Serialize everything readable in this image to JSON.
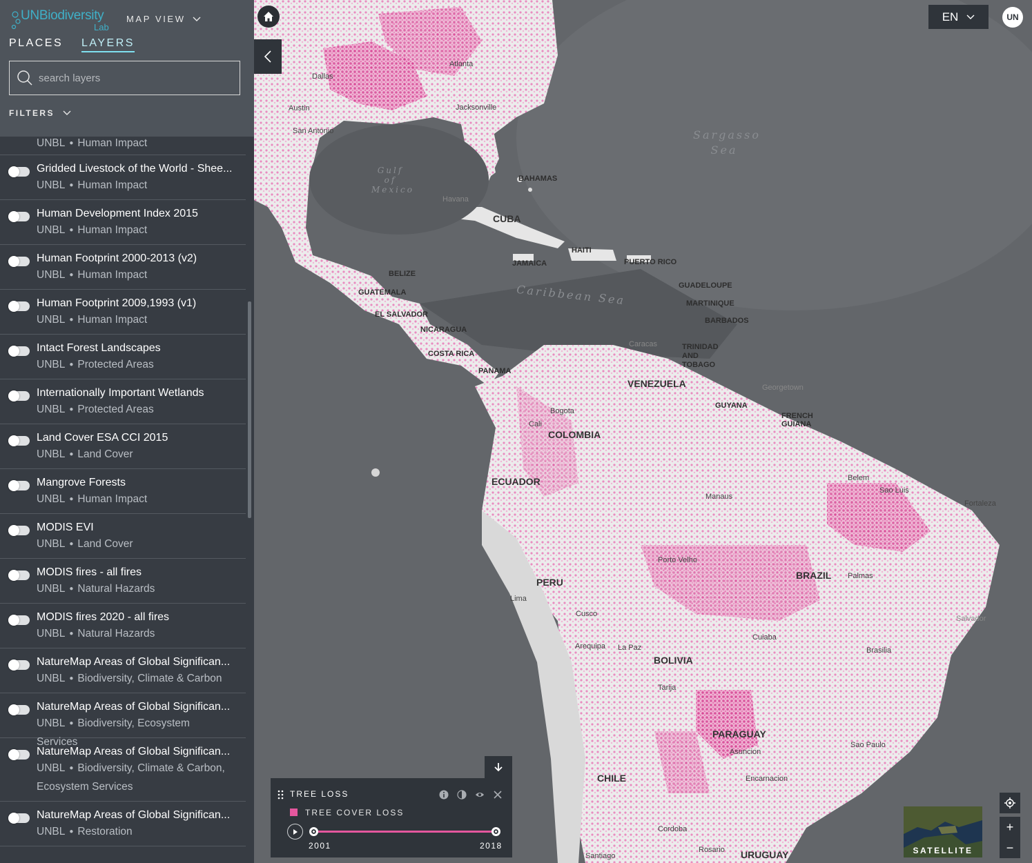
{
  "brand": {
    "logo_main": "UNBiodiversity",
    "logo_sub": "Lab"
  },
  "header": {
    "map_view": "MAP VIEW"
  },
  "tabs": [
    {
      "label": "PLACES"
    },
    {
      "label": "LAYERS"
    }
  ],
  "search": {
    "placeholder": "search layers"
  },
  "filters": {
    "label": "FILTERS"
  },
  "layer_list": {
    "top_partial": {
      "source": "UNBL",
      "category": "Human Impact"
    },
    "items": [
      {
        "name": "Gridded Livestock of the World - Shee...",
        "source": "UNBL",
        "category": "Human Impact"
      },
      {
        "name": "Human Development Index 2015",
        "source": "UNBL",
        "category": "Human Impact"
      },
      {
        "name": "Human Footprint 2000-2013 (v2)",
        "source": "UNBL",
        "category": "Human Impact"
      },
      {
        "name": "Human Footprint 2009,1993 (v1)",
        "source": "UNBL",
        "category": "Human Impact"
      },
      {
        "name": "Intact Forest Landscapes",
        "source": "UNBL",
        "category": "Protected Areas"
      },
      {
        "name": "Internationally Important Wetlands",
        "source": "UNBL",
        "category": "Protected Areas"
      },
      {
        "name": "Land Cover ESA CCI 2015",
        "source": "UNBL",
        "category": "Land Cover"
      },
      {
        "name": "Mangrove Forests",
        "source": "UNBL",
        "category": "Human Impact"
      },
      {
        "name": "MODIS EVI",
        "source": "UNBL",
        "category": "Land Cover"
      },
      {
        "name": "MODIS fires - all fires",
        "source": "UNBL",
        "category": "Natural Hazards"
      },
      {
        "name": "MODIS fires 2020 - all fires",
        "source": "UNBL",
        "category": "Natural Hazards"
      },
      {
        "name": "NatureMap Areas of Global Significan...",
        "source": "UNBL",
        "category": "Biodiversity, Climate & Carbon"
      },
      {
        "name": "NatureMap Areas of Global Significan...",
        "source": "UNBL",
        "category": "Biodiversity, Ecosystem Services"
      },
      {
        "name": "NatureMap Areas of Global Significan...",
        "source": "UNBL",
        "category": "Biodiversity, Climate & Carbon, Ecosystem Services"
      },
      {
        "name": "NatureMap Areas of Global Significan...",
        "source": "UNBL",
        "category": "Restoration"
      }
    ]
  },
  "topbar": {
    "language": "EN",
    "user_initials": "UN"
  },
  "legend": {
    "title": "TREE LOSS",
    "item_label": "TREE COVER LOSS",
    "item_color": "#e5579e",
    "year_start": "2001",
    "year_end": "2018"
  },
  "basemap": {
    "label": "SATELLITE"
  },
  "zoom": {
    "in": "+",
    "out": "−"
  },
  "map_labels": {
    "countries": [
      "CUBA",
      "HAITI",
      "JAMAICA",
      "PUERTO RICO",
      "BAHAMAS",
      "BELIZE",
      "GUATEMALA",
      "EL SALVADOR",
      "NICARAGUA",
      "COSTA RICA",
      "PANAMA",
      "VENEZUELA",
      "GUYANA",
      "FRENCH GUIANA",
      "COLOMBIA",
      "ECUADOR",
      "PERU",
      "BRAZIL",
      "BOLIVIA",
      "PARAGUAY",
      "CHILE",
      "URUGUAY",
      "GUADELOUPE",
      "MARTINIQUE",
      "BARBADOS",
      "TRINIDAD AND TOBAGO"
    ],
    "seas": [
      "Sargasso Sea",
      "Gulf of Mexico",
      "Caribbean Sea"
    ],
    "cities": [
      "Atlanta",
      "Dallas",
      "Austin",
      "San Antonio",
      "Jacksonville",
      "Havana",
      "Caracas",
      "Bogota",
      "Cali",
      "Manaus",
      "Belem",
      "Sao Luis",
      "Fortaleza",
      "Lima",
      "Cusco",
      "La Paz",
      "Brasilia",
      "Sao Paulo",
      "Asuncion",
      "Cordoba",
      "Rosario",
      "Santiago",
      "Georgetown",
      "Porto Velho",
      "Cuiaba",
      "Salvador",
      "Palmas",
      "Arequipa",
      "Tarija",
      "Encarnacion"
    ]
  }
}
